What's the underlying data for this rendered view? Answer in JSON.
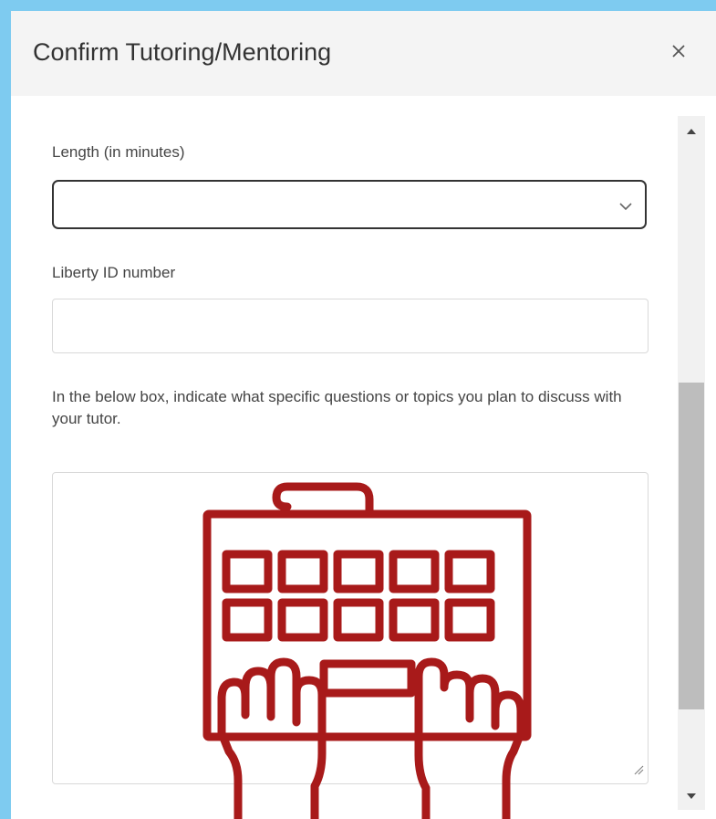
{
  "dialog": {
    "title": "Confirm Tutoring/Mentoring",
    "close_icon": "close-icon"
  },
  "form": {
    "length_label": "Length (in minutes)",
    "length_value": "",
    "length_chevron_icon": "chevron-down-icon",
    "liberty_id_label": "Liberty ID number",
    "liberty_id_value": "",
    "topics_help": "In the below box, indicate what specific questions or topics you plan to discuss with your tutor.",
    "topics_value": ""
  },
  "illustration": {
    "icon": "keyboard-typing-hands-icon",
    "color": "#a81a1a"
  },
  "colors": {
    "background": "#7ecbf0",
    "header": "#f4f4f4",
    "scroll_thumb": "#bdbdbd"
  }
}
